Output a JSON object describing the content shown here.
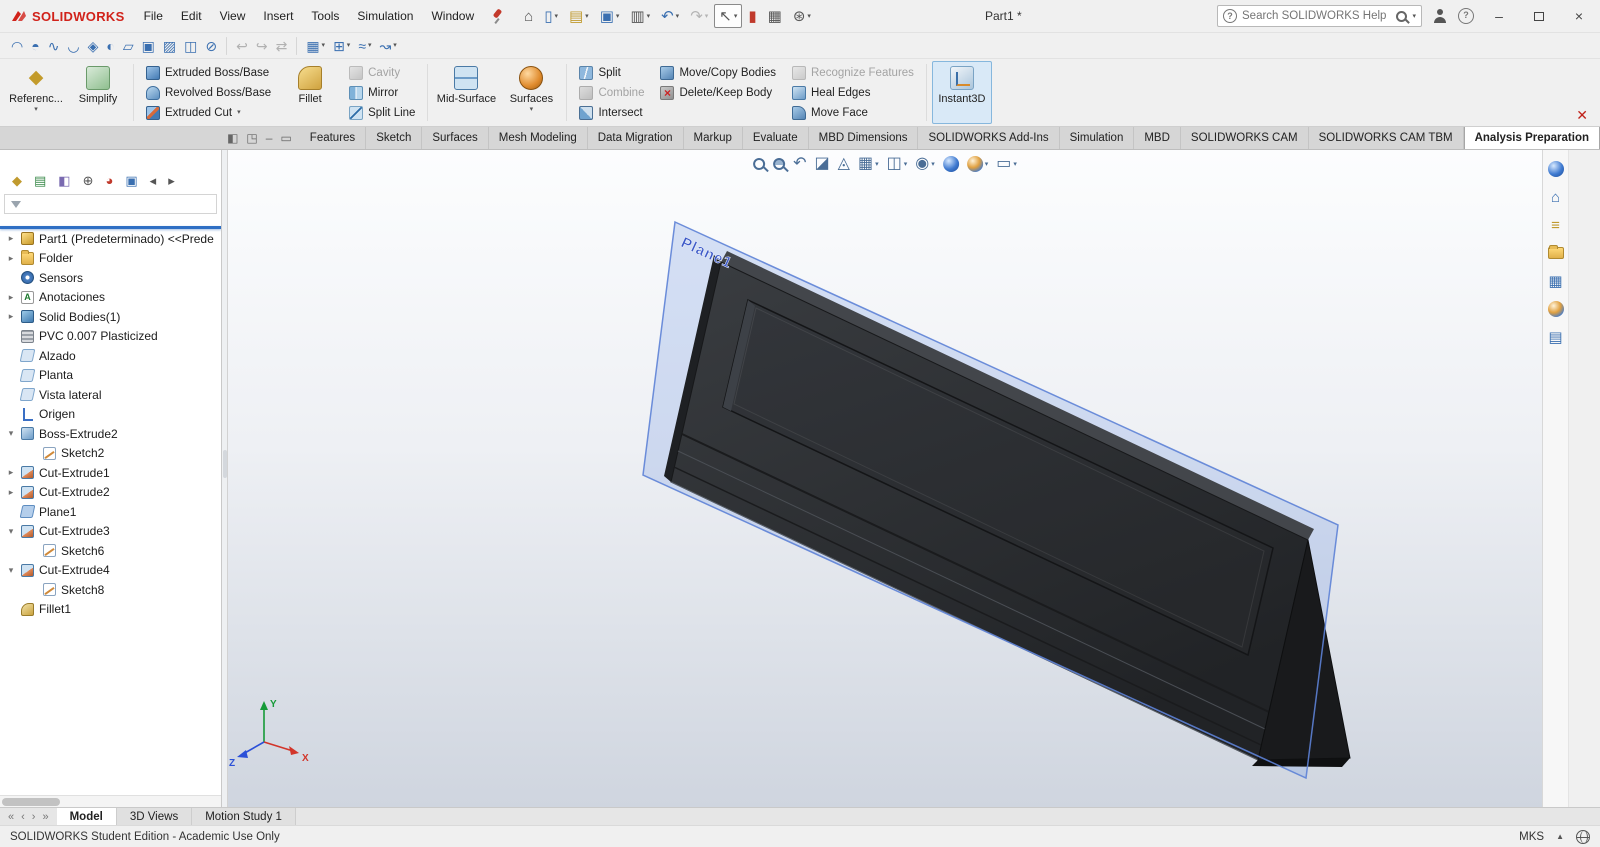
{
  "titlebar": {
    "logo_text": "SOLIDWORKS",
    "menus": [
      "File",
      "Edit",
      "View",
      "Insert",
      "Tools",
      "Simulation",
      "Window"
    ],
    "doc_title": "Part1 *",
    "search_placeholder": "Search SOLIDWORKS Help",
    "quick_tools": [
      {
        "name": "home-button",
        "glyph": "⌂",
        "tone": "gray"
      },
      {
        "name": "new-document-button",
        "glyph": "▯",
        "tone": "blue",
        "dropdown": true
      },
      {
        "name": "open-button",
        "glyph": "▤",
        "tone": "gold",
        "dropdown": true
      },
      {
        "name": "save-button",
        "glyph": "▣",
        "tone": "blue",
        "dropdown": true
      },
      {
        "name": "print-button",
        "glyph": "▥",
        "tone": "gray",
        "dropdown": true
      },
      {
        "name": "undo-button",
        "glyph": "↶",
        "tone": "blue",
        "dropdown": true
      },
      {
        "name": "redo-button",
        "glyph": "↷",
        "tone": "gray",
        "dropdown": true,
        "disabled": true
      },
      {
        "name": "select-button",
        "glyph": "↖",
        "tone": "gray",
        "dropdown": true,
        "pressed": true
      },
      {
        "name": "record-macro-button",
        "glyph": "▮",
        "tone": "red"
      },
      {
        "name": "file-properties-button",
        "glyph": "▦",
        "tone": "gray"
      },
      {
        "name": "options-button",
        "glyph": "⊛",
        "tone": "gray",
        "dropdown": true
      }
    ]
  },
  "toolbar2": {
    "icons": [
      {
        "name": "extruded-surface-button",
        "glyph": "◠",
        "tone": "blue"
      },
      {
        "name": "revolved-surface-button",
        "glyph": "◓",
        "tone": "blue"
      },
      {
        "name": "swept-surface-button",
        "glyph": "∿",
        "tone": "blue"
      },
      {
        "name": "lofted-surface-button",
        "glyph": "◡",
        "tone": "blue"
      },
      {
        "name": "boundary-surface-button",
        "glyph": "◈",
        "tone": "blue"
      },
      {
        "name": "filled-surface-button",
        "glyph": "◐",
        "tone": "blue"
      },
      {
        "name": "planar-surface-button",
        "glyph": "▱",
        "tone": "blue"
      },
      {
        "name": "offset-surface-button",
        "glyph": "▣",
        "tone": "blue"
      },
      {
        "name": "ruled-surface-button",
        "glyph": "▨",
        "tone": "blue"
      },
      {
        "name": "knit-surface-button",
        "glyph": "◫",
        "tone": "blue"
      },
      {
        "name": "trim-surface-button",
        "glyph": "⊘",
        "tone": "blue"
      },
      {
        "name": "toolbar-separator",
        "sep": true
      },
      {
        "name": "undo-view-button",
        "glyph": "↩",
        "tone": "gray",
        "disabled": true
      },
      {
        "name": "redo-view-button",
        "glyph": "↪",
        "tone": "gray",
        "disabled": true
      },
      {
        "name": "swap-view-button",
        "glyph": "⇄",
        "tone": "gray",
        "disabled": true
      },
      {
        "name": "toolbar-separator",
        "sep": true
      },
      {
        "name": "view-cube-button",
        "glyph": "▦",
        "tone": "blue",
        "dropdown": true
      },
      {
        "name": "measure-button",
        "glyph": "⊞",
        "tone": "blue",
        "dropdown": true
      },
      {
        "name": "spline-tools-button",
        "glyph": "≈",
        "tone": "blue",
        "dropdown": true
      },
      {
        "name": "curve-tools-button",
        "glyph": "↝",
        "tone": "blue",
        "dropdown": true
      }
    ]
  },
  "ribbon": {
    "reference": "Referenc...",
    "simplify": "Simplify",
    "extruded_boss": "Extruded Boss/Base",
    "revolved_boss": "Revolved Boss/Base",
    "extruded_cut": "Extruded Cut",
    "fillet": "Fillet",
    "cavity": "Cavity",
    "mirror": "Mirror",
    "split_line": "Split Line",
    "mid_surface": "Mid-Surface",
    "surfaces": "Surfaces",
    "split": "Split",
    "combine": "Combine",
    "intersect": "Intersect",
    "move_copy": "Move/Copy Bodies",
    "delete_keep": "Delete/Keep Body",
    "recognize": "Recognize Features",
    "heal_edges": "Heal Edges",
    "move_face": "Move Face",
    "instant3d": "Instant3D"
  },
  "command_tabs": [
    {
      "label": "Features"
    },
    {
      "label": "Sketch"
    },
    {
      "label": "Surfaces"
    },
    {
      "label": "Mesh Modeling"
    },
    {
      "label": "Data Migration"
    },
    {
      "label": "Markup"
    },
    {
      "label": "Evaluate"
    },
    {
      "label": "MBD Dimensions"
    },
    {
      "label": "SOLIDWORKS Add-Ins"
    },
    {
      "label": "Simulation"
    },
    {
      "label": "MBD"
    },
    {
      "label": "SOLIDWORKS CAM"
    },
    {
      "label": "SOLIDWORKS CAM TBM"
    },
    {
      "label": "Analysis Preparation",
      "active": true
    }
  ],
  "tree": {
    "toolbar": [
      {
        "name": "featuremanager-tree-tab",
        "glyph": "◆",
        "tone": "gold"
      },
      {
        "name": "propertymanager-tab",
        "glyph": "▤",
        "tone": "green"
      },
      {
        "name": "configurationmanager-tab",
        "glyph": "◧",
        "tone": "purple"
      },
      {
        "name": "dimxpertmanager-tab",
        "glyph": "⊕",
        "tone": "gray"
      },
      {
        "name": "displaymanager-tab",
        "glyph": "◕",
        "tone": "red"
      },
      {
        "name": "cam-tree-tab",
        "glyph": "▣",
        "tone": "blue"
      },
      {
        "name": "tree-tab-scroll-left",
        "glyph": "◂",
        "tone": "gray"
      },
      {
        "name": "tree-tab-scroll-right",
        "glyph": "▸",
        "tone": "gray"
      }
    ],
    "items": [
      {
        "label": "Part1 (Predeterminado) <<Prede",
        "icon": "part",
        "arrow": "▸"
      },
      {
        "label": "Folder",
        "icon": "folder",
        "arrow": "▸"
      },
      {
        "label": "Sensors",
        "icon": "sensors",
        "arrow": ""
      },
      {
        "label": "Anotaciones",
        "icon": "annotations",
        "arrow": "▸"
      },
      {
        "label": "Solid Bodies(1)",
        "icon": "solidbodies",
        "arrow": "▸"
      },
      {
        "label": "PVC 0.007 Plasticized",
        "icon": "material",
        "arrow": ""
      },
      {
        "label": "Alzado",
        "icon": "plane",
        "arrow": ""
      },
      {
        "label": "Planta",
        "icon": "plane",
        "arrow": ""
      },
      {
        "label": "Vista lateral",
        "icon": "plane",
        "arrow": ""
      },
      {
        "label": "Origen",
        "icon": "origin",
        "arrow": ""
      },
      {
        "label": "Boss-Extrude2",
        "icon": "boss-extrude",
        "arrow": "▾"
      },
      {
        "label": "Sketch2",
        "icon": "sketch",
        "arrow": "",
        "indent": 1
      },
      {
        "label": "Cut-Extrude1",
        "icon": "cut-extrude",
        "arrow": "▸"
      },
      {
        "label": "Cut-Extrude2",
        "icon": "cut-extrude",
        "arrow": "▸"
      },
      {
        "label": "Plane1",
        "icon": "plane-feature",
        "arrow": ""
      },
      {
        "label": "Cut-Extrude3",
        "icon": "cut-extrude",
        "arrow": "▾"
      },
      {
        "label": "Sketch6",
        "icon": "sketch",
        "arrow": "",
        "indent": 1
      },
      {
        "label": "Cut-Extrude4",
        "icon": "cut-extrude",
        "arrow": "▾"
      },
      {
        "label": "Sketch8",
        "icon": "sketch",
        "arrow": "",
        "indent": 1
      },
      {
        "label": "Fillet1",
        "icon": "fillet",
        "arrow": ""
      }
    ]
  },
  "viewport": {
    "plane_label": "Plane1",
    "triad": {
      "x": "X",
      "y": "Y",
      "z": "Z"
    },
    "hud": [
      {
        "name": "zoom-to-fit-button",
        "icon": "magl"
      },
      {
        "name": "zoom-to-area-button",
        "icon": "magarea"
      },
      {
        "name": "previous-view-button",
        "glyph": "↶"
      },
      {
        "name": "section-view-button",
        "glyph": "◪"
      },
      {
        "name": "dynamic-annotation-views-button",
        "glyph": "◬"
      },
      {
        "name": "view-orientation-button",
        "glyph": "▦",
        "dropdown": true
      },
      {
        "name": "display-style-button",
        "glyph": "◫",
        "dropdown": true
      },
      {
        "name": "hide-show-items-button",
        "glyph": "◉",
        "dropdown": true
      },
      {
        "name": "edit-appearance-button",
        "icon": "ballblue"
      },
      {
        "name": "apply-scene-button",
        "icon": "ballmulti",
        "dropdown": true
      },
      {
        "name": "view-settings-button",
        "glyph": "▭",
        "dropdown": true
      }
    ]
  },
  "rightbar": {
    "icons": [
      {
        "name": "solidworks-resources-button",
        "icon": "ballblue"
      },
      {
        "name": "home-tab-button",
        "glyph": "⌂",
        "tone": "blue"
      },
      {
        "name": "design-library-button",
        "glyph": "≡",
        "tone": "gold"
      },
      {
        "name": "file-explorer-button",
        "icon": "cssfolder"
      },
      {
        "name": "view-palette-button",
        "glyph": "▦",
        "tone": "blue"
      },
      {
        "name": "appearances-button",
        "icon": "ballmulti"
      },
      {
        "name": "custom-properties-button",
        "glyph": "▤",
        "tone": "blue"
      }
    ]
  },
  "bottom": {
    "nav": [
      {
        "name": "model-tab-scroll-first-button",
        "glyph": "«"
      },
      {
        "name": "model-tab-scroll-prev-button",
        "glyph": "‹"
      },
      {
        "name": "model-tab-scroll-next-button",
        "glyph": "›"
      },
      {
        "name": "model-tab-scroll-last-button",
        "glyph": "»"
      }
    ],
    "tabs": [
      {
        "label": "Model",
        "active": true
      },
      {
        "label": "3D Views"
      },
      {
        "label": "Motion Study 1"
      }
    ]
  },
  "statusbar": {
    "left": "SOLIDWORKS Student Edition - Academic Use Only",
    "units": "MKS"
  }
}
